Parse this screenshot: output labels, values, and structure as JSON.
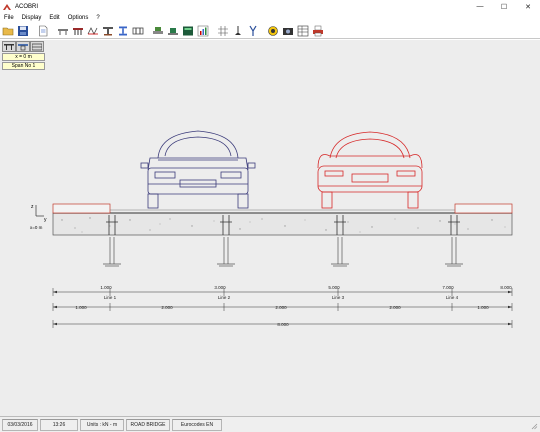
{
  "window": {
    "title": "ACOBRI",
    "minimize": "—",
    "maximize": "☐",
    "close": "✕"
  },
  "menu": [
    "File",
    "Display",
    "Edit",
    "Options",
    "?"
  ],
  "toolbar_icons": [
    "open-folder-icon",
    "save-disk-icon",
    "document-icon",
    "bridge-deck-icon",
    "cross-section-icon",
    "truss-icon",
    "beam-section-icon",
    "i-beam-icon",
    "girder-icon",
    "traffic-lane-icon",
    "vehicle-load-icon",
    "load-case-icon",
    "chart-icon",
    "grid-icon",
    "support-icon",
    "fork-icon",
    "results-icon",
    "camera-icon",
    "table-icon",
    "print-icon"
  ],
  "panel": {
    "position_field": "x = 0 m",
    "span_field": "Span No 1"
  },
  "drawing": {
    "axis_label": "x=0 m",
    "axis_z": "z",
    "axis_y": "y",
    "marks": [
      "1.000",
      "3.000",
      "5.000",
      "7.000",
      "8.000"
    ],
    "lines": [
      "Line 1",
      "Line 2",
      "Line 3",
      "Line 4"
    ],
    "spacings": [
      "1.000",
      "2.000",
      "2.000",
      "2.000",
      "1.000"
    ],
    "total": "8.000"
  },
  "status": {
    "date": "03/03/2016",
    "time": "13:26",
    "units": "Units : kN - m",
    "structure": "ROAD BRIDGE",
    "code": "Eurocodes EN"
  },
  "colors": {
    "left_car": "#3b3b7a",
    "right_car": "#d62828",
    "deck_outline": "#c0392b",
    "background": "#ededed"
  }
}
